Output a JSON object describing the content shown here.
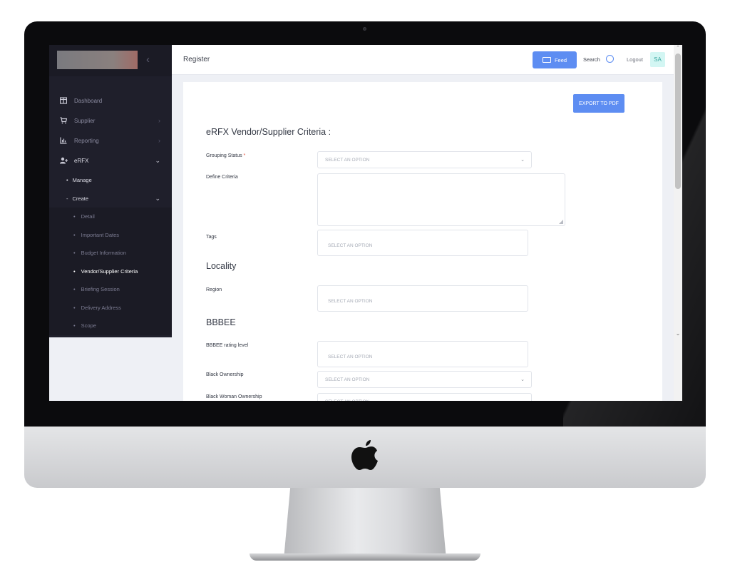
{
  "sidebar": {
    "collapse_icon": "chevron-left-icon",
    "items": [
      {
        "label": "Dashboard",
        "icon": "dashboard-icon"
      },
      {
        "label": "Supplier",
        "icon": "cart-icon"
      },
      {
        "label": "Reporting",
        "icon": "chart-icon"
      },
      {
        "label": "eRFX",
        "icon": "user-add-icon"
      }
    ],
    "erfx_sub": {
      "manage": "Manage",
      "create": "Create"
    },
    "create_items": [
      "Detail",
      "Important Dates",
      "Budget Information",
      "Vendor/Supplier Criteria",
      "Briefing Session",
      "Delivery Address",
      "Scope"
    ]
  },
  "topbar": {
    "title": "Register",
    "feed_label": "Feed",
    "search_label": "Search",
    "logout_label": "Logout",
    "avatar_initials": "SA"
  },
  "form": {
    "export_label": "EXPORT TO PDF",
    "section_criteria": "eRFX Vendor/Supplier Criteria :",
    "grouping_status_label": "Grouping Status",
    "required_mark": "*",
    "define_criteria_label": "Define Criteria",
    "tags_label": "Tags",
    "section_locality": "Locality",
    "region_label": "Region",
    "section_bbbee": "BBBEE",
    "bbbee_rating_label": "BBBEE rating level",
    "black_ownership_label": "Black Ownership",
    "black_woman_ownership_label": "Black Woman Ownership",
    "placeholder": "SELECT AN OPTION"
  },
  "colors": {
    "accent": "#5d8df2",
    "sidebar_bg": "#1f1f2b",
    "required": "#e5533b"
  }
}
